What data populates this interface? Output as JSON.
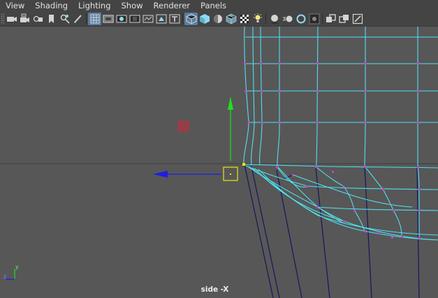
{
  "menu": [
    "View",
    "Shading",
    "Lighting",
    "Show",
    "Renderer",
    "Panels"
  ],
  "toolbar": {
    "groups": [
      [
        "camera-icon",
        "camera-attributes-icon",
        "bookmark-camera-icon",
        "image-plane-icon",
        "pan-zoom-icon",
        "grease-pencil-icon"
      ],
      [
        "grid-icon",
        "film-gate-icon",
        "resolution-gate-icon",
        "gate-mask-icon",
        "field-chart-icon",
        "safe-action-icon",
        "safe-title-icon"
      ],
      [
        "wireframe-icon",
        "smooth-shade-icon",
        "default-material-icon",
        "textured-icon",
        "use-all-lights-icon",
        "shadows-icon"
      ],
      [
        "screen-space-ao-icon",
        "motion-blur-icon",
        "anti-aliasing-icon",
        "depth-of-field-icon"
      ],
      [
        "isolate-select-icon",
        "xray-icon",
        "xray-joints-icon"
      ]
    ],
    "active": [
      "grid-icon",
      "wireframe-icon"
    ]
  },
  "viewport": {
    "camera_label": "side -X",
    "axis_indicator": {
      "y_label": "y",
      "z_label": "z"
    }
  },
  "colors": {
    "viewport_bg": "#575757",
    "wire": "#4fe0ef",
    "wire_dark": "#16165e",
    "vertex": "#d23dd2",
    "manip_y": "#1ee01e",
    "manip_z": "#1e1ee6",
    "pivot": "#e8e80e",
    "center_handle": "#a03a48"
  }
}
